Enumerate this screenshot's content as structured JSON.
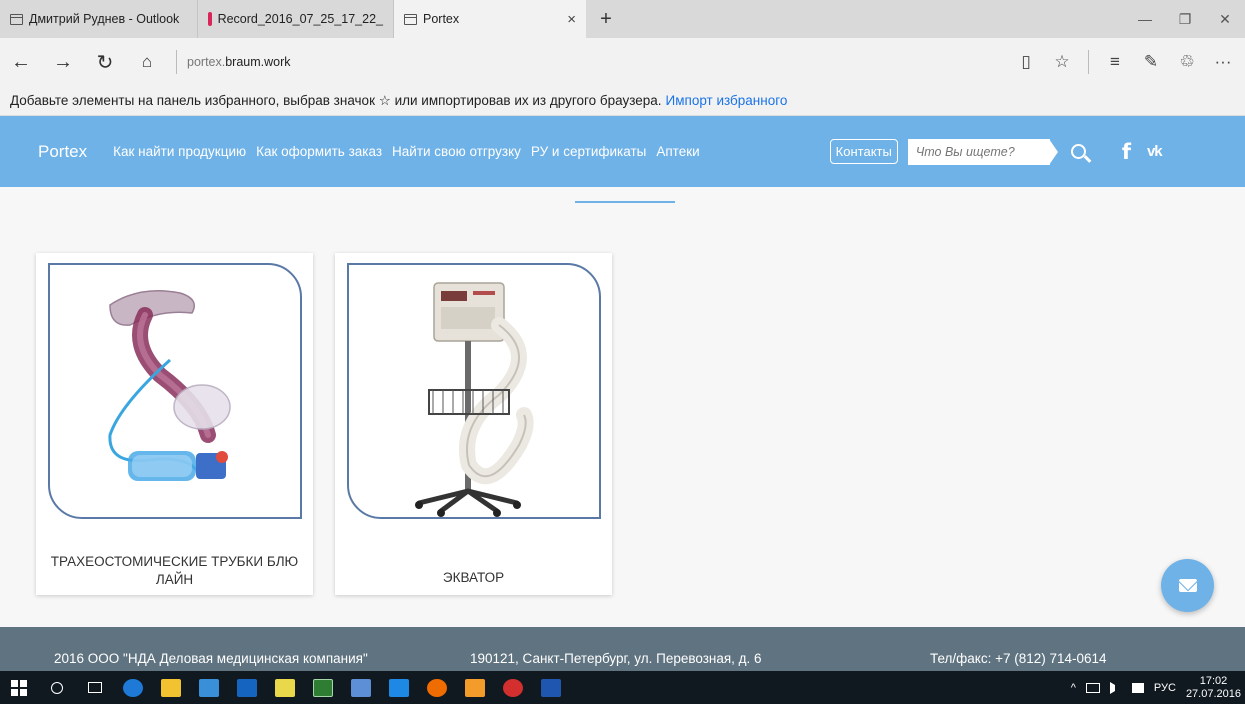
{
  "browser": {
    "tabs": [
      {
        "title": "Дмитрий Руднев - Outlook",
        "icon": "window-icon"
      },
      {
        "title": "Record_2016_07_25_17_22_",
        "icon": "clapperboard-icon"
      },
      {
        "title": "Portex",
        "icon": "window-icon",
        "active": true
      }
    ],
    "new_tab": "+",
    "close_tab": "×",
    "window_controls": {
      "minimize": "—",
      "restore": "❐",
      "close": "✕"
    },
    "nav": {
      "back": "←",
      "forward": "→",
      "refresh": "↻",
      "home": "⌂"
    },
    "address": {
      "prefix": "portex.",
      "host": "braum.work"
    },
    "toolbar": {
      "reading_view": "▯",
      "favorite": "☆",
      "hub": "≡",
      "note": "✎",
      "share": "♲",
      "more": "···"
    }
  },
  "favorites_bar": {
    "text": "Добавьте элементы на панель избранного, выбрав значок ☆ или импортировав их из другого браузера.",
    "link": "Импорт избранного"
  },
  "site": {
    "logo": "Portex",
    "menu": [
      "Как найти продукцию",
      "Как оформить заказ",
      "Найти свою отгрузку",
      "РУ и сертификаты",
      "Аптеки"
    ],
    "contacts": "Контакты",
    "search_placeholder": "Что Вы ищете?",
    "social": {
      "facebook": "f",
      "vk": "vk"
    },
    "accent_color": "#6fb2e8"
  },
  "products": [
    {
      "title": "ТРАХЕОСТОМИЧЕСКИЕ ТРУБКИ БЛЮ ЛАЙН"
    },
    {
      "title": "ЭКВАТОР"
    }
  ],
  "footer": {
    "company": "2016 ООО \"НДА Деловая медицинская компания\"",
    "address": "190121, Санкт-Петербург, ул. Перевозная, д. 6",
    "phone": "Тел/факс: +7 (812) 714-0614",
    "background": "#5f7380"
  },
  "taskbar": {
    "tray": {
      "chevron": "^",
      "language": "РУС",
      "time": "17:02",
      "date": "27.07.2016"
    }
  }
}
